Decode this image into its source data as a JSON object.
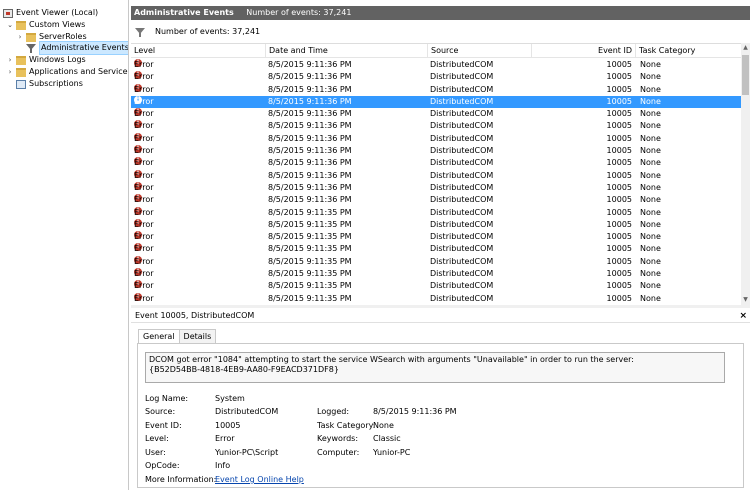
{
  "tree": {
    "items": [
      {
        "label": "Event Viewer (Local)"
      },
      {
        "label": "Custom Views"
      },
      {
        "label": "ServerRoles"
      },
      {
        "label": "Administrative Events"
      },
      {
        "label": "Windows Logs"
      },
      {
        "label": "Applications and Services Lo"
      },
      {
        "label": "Subscriptions"
      }
    ]
  },
  "header": {
    "title": "Administrative Events",
    "count": "Number of events: 37,241"
  },
  "filterbar": {
    "text": "Number of events: 37,241"
  },
  "columns": [
    "Level",
    "Date and Time",
    "Source",
    "Event ID",
    "Task Category"
  ],
  "rows": [
    {
      "level": "Error",
      "date": "8/5/2015 9:11:36 PM",
      "source": "DistributedCOM",
      "id": "10005",
      "cat": "None"
    },
    {
      "level": "Error",
      "date": "8/5/2015 9:11:36 PM",
      "source": "DistributedCOM",
      "id": "10005",
      "cat": "None"
    },
    {
      "level": "Error",
      "date": "8/5/2015 9:11:36 PM",
      "source": "DistributedCOM",
      "id": "10005",
      "cat": "None"
    },
    {
      "level": "Error",
      "date": "8/5/2015 9:11:36 PM",
      "source": "DistributedCOM",
      "id": "10005",
      "cat": "None"
    },
    {
      "level": "Error",
      "date": "8/5/2015 9:11:36 PM",
      "source": "DistributedCOM",
      "id": "10005",
      "cat": "None"
    },
    {
      "level": "Error",
      "date": "8/5/2015 9:11:36 PM",
      "source": "DistributedCOM",
      "id": "10005",
      "cat": "None"
    },
    {
      "level": "Error",
      "date": "8/5/2015 9:11:36 PM",
      "source": "DistributedCOM",
      "id": "10005",
      "cat": "None"
    },
    {
      "level": "Error",
      "date": "8/5/2015 9:11:36 PM",
      "source": "DistributedCOM",
      "id": "10005",
      "cat": "None"
    },
    {
      "level": "Error",
      "date": "8/5/2015 9:11:36 PM",
      "source": "DistributedCOM",
      "id": "10005",
      "cat": "None"
    },
    {
      "level": "Error",
      "date": "8/5/2015 9:11:36 PM",
      "source": "DistributedCOM",
      "id": "10005",
      "cat": "None"
    },
    {
      "level": "Error",
      "date": "8/5/2015 9:11:36 PM",
      "source": "DistributedCOM",
      "id": "10005",
      "cat": "None"
    },
    {
      "level": "Error",
      "date": "8/5/2015 9:11:36 PM",
      "source": "DistributedCOM",
      "id": "10005",
      "cat": "None"
    },
    {
      "level": "Error",
      "date": "8/5/2015 9:11:35 PM",
      "source": "DistributedCOM",
      "id": "10005",
      "cat": "None"
    },
    {
      "level": "Error",
      "date": "8/5/2015 9:11:35 PM",
      "source": "DistributedCOM",
      "id": "10005",
      "cat": "None"
    },
    {
      "level": "Error",
      "date": "8/5/2015 9:11:35 PM",
      "source": "DistributedCOM",
      "id": "10005",
      "cat": "None"
    },
    {
      "level": "Error",
      "date": "8/5/2015 9:11:35 PM",
      "source": "DistributedCOM",
      "id": "10005",
      "cat": "None"
    },
    {
      "level": "Error",
      "date": "8/5/2015 9:11:35 PM",
      "source": "DistributedCOM",
      "id": "10005",
      "cat": "None"
    },
    {
      "level": "Error",
      "date": "8/5/2015 9:11:35 PM",
      "source": "DistributedCOM",
      "id": "10005",
      "cat": "None"
    },
    {
      "level": "Error",
      "date": "8/5/2015 9:11:35 PM",
      "source": "DistributedCOM",
      "id": "10005",
      "cat": "None"
    },
    {
      "level": "Error",
      "date": "8/5/2015 9:11:35 PM",
      "source": "DistributedCOM",
      "id": "10005",
      "cat": "None"
    }
  ],
  "selected_row": 3,
  "detail": {
    "title": "Event 10005, DistributedCOM",
    "close": "×",
    "tabs": [
      "General",
      "Details"
    ],
    "message_line1": "DCOM got error \"1084\" attempting to start the service WSearch with arguments \"Unavailable\" in order to run the server:",
    "message_line2": "{B52D54BB-4818-4EB9-AA80-F9EACD371DF8}",
    "log_name_label": "Log Name:",
    "log_name": "System",
    "source_label": "Source:",
    "source": "DistributedCOM",
    "logged_label": "Logged:",
    "logged": "8/5/2015 9:11:36 PM",
    "event_id_label": "Event ID:",
    "event_id": "10005",
    "task_label": "Task Category:",
    "task": "None",
    "level_label": "Level:",
    "level": "Error",
    "keywords_label": "Keywords:",
    "keywords": "Classic",
    "user_label": "User:",
    "user": "Yunior-PC\\Script",
    "computer_label": "Computer:",
    "computer": "Yunior-PC",
    "opcode_label": "OpCode:",
    "opcode": "Info",
    "more_label": "More Information:",
    "more_link": "Event Log Online Help"
  },
  "colors": {
    "selection": "#3399ff",
    "header": "#626262",
    "error": "#c0392b",
    "link": "#0645ad"
  }
}
